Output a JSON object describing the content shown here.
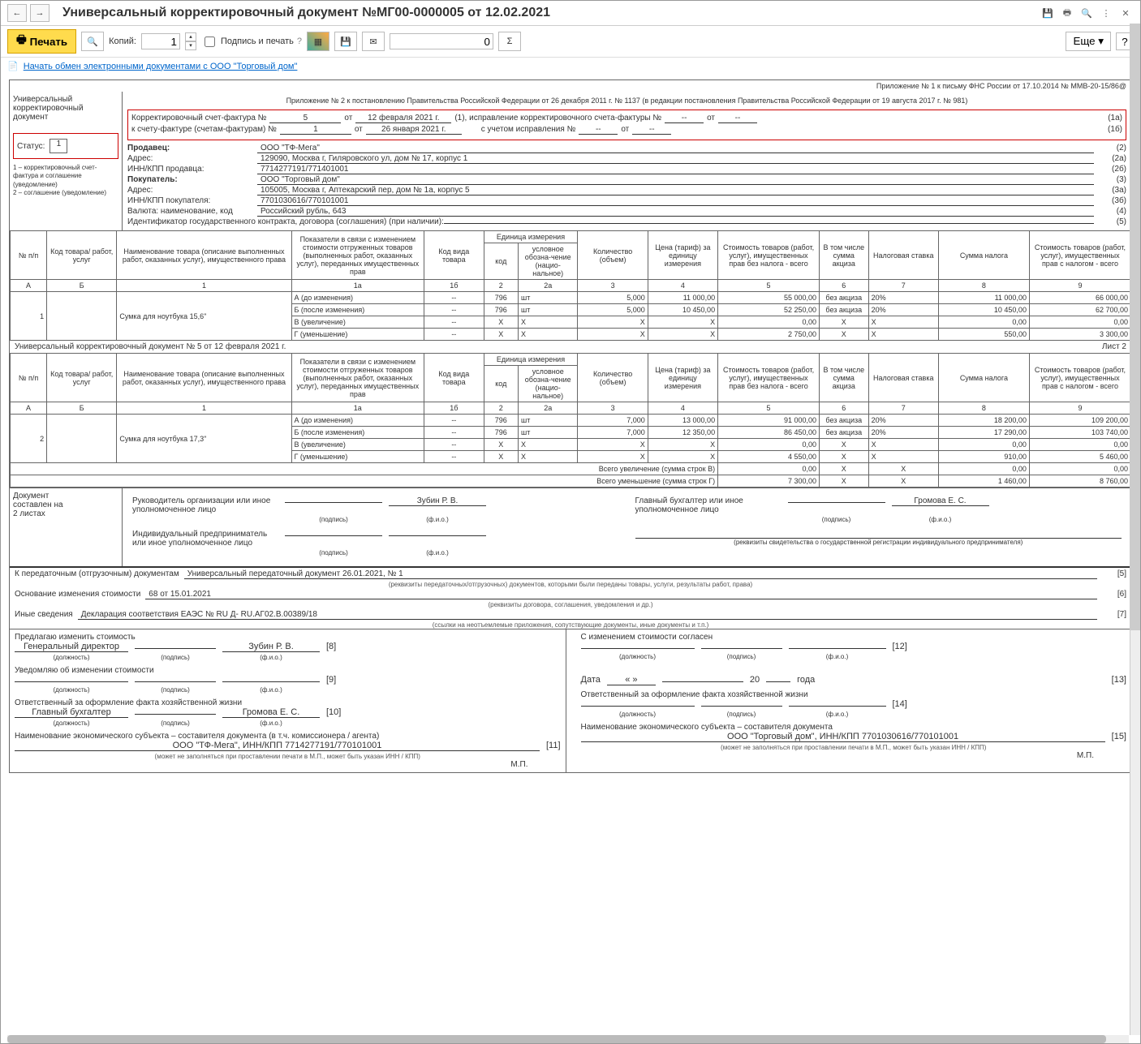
{
  "title": "Универсальный корректировочный документ №МГ00-0000005 от 12.02.2021",
  "toolbar": {
    "print": "Печать",
    "copies_label": "Копий:",
    "copies_value": "1",
    "sign_print": "Подпись и печать",
    "sum_value": "0",
    "more": "Еще",
    "help": "?",
    "sigma": "Σ"
  },
  "linkbar": {
    "link": "Начать обмен электронными документами с ООО \"Торговый дом\""
  },
  "left": {
    "title": "Универсальный корректировочный документ",
    "status_label": "Статус:",
    "status_value": "1",
    "legend": "1 – корректировочный счет-фактура и соглашение (уведомление)\n2 – соглашение (уведомление)"
  },
  "appendix": {
    "l1": "Приложение № 1 к письму ФНС России от 17.10.2014 № ММВ-20-15/86@",
    "l2": "Приложение № 2 к постановлению Правительства Российской Федерации от 26 декабря 2011 г. № 1137 (в редакции постановления Правительства Российской Федерации от 19 августа 2017 г. № 981)"
  },
  "hdr": {
    "l1_label": "Корректировочный счет-фактура №",
    "l1_num": "5",
    "l1_ot": "от",
    "l1_date": "12 февраля 2021 г.",
    "l1_after": "(1),  исправление корректировочного счета-фактуры №",
    "l1_dash": "--",
    "l1_ot2": "от",
    "l1_dash2": "--",
    "l1_code": "(1а)",
    "l2_label": "к счету-фактуре (счетам-фактурам) №",
    "l2_num": "1",
    "l2_ot": "от",
    "l2_date": "26 января 2021 г.",
    "l2_after": "с учетом исправления №",
    "l2_dash": "--",
    "l2_ot2": "от",
    "l2_dash2": "--",
    "l2_code": "(1б)"
  },
  "seller": {
    "label": "Продавец:",
    "val": "ООО \"ТФ-Мега\"",
    "code": "(2)"
  },
  "seller_addr": {
    "label": "Адрес:",
    "val": "129090, Москва г, Гиляровского ул, дом № 17, корпус 1",
    "code": "(2а)"
  },
  "seller_inn": {
    "label": "ИНН/КПП продавца:",
    "val": "7714277191/771401001",
    "code": "(2б)"
  },
  "buyer": {
    "label": "Покупатель:",
    "val": "ООО \"Торговый дом\"",
    "code": "(3)"
  },
  "buyer_addr": {
    "label": "Адрес:",
    "val": "105005, Москва г, Аптекарский пер, дом № 1а, корпус 5",
    "code": "(3а)"
  },
  "buyer_inn": {
    "label": "ИНН/КПП покупателя:",
    "val": "7701030616/770101001",
    "code": "(3б)"
  },
  "currency": {
    "label": "Валюта: наименование, код",
    "val": "Российский рубль, 643",
    "code": "(4)"
  },
  "contract": {
    "label": "Идентификатор государственного контракта, договора (соглашения) (при наличии):",
    "val": "",
    "code": "(5)"
  },
  "th": {
    "np": "№ п/п",
    "code": "Код товара/ работ, услуг",
    "name": "Наименование товара (описание выполненных работ, оказанных услуг), имущественного права",
    "ind": "Показатели в связи с изменением стоимости отгруженных товаров (выполненных работ, оказанных услуг), переданных имущественных прав",
    "kvt": "Код вида товара",
    "unit": "Единица измерения",
    "ucode": "код",
    "uname": "условное обозна-чение (нацио-нальное)",
    "qty": "Количество (объем)",
    "price": "Цена (тариф) за единицу измерения",
    "cost_no_tax": "Стоимость товаров (работ, услуг), имущественных прав без налога - всего",
    "excise": "В том числе сумма акциза",
    "rate": "Налоговая ставка",
    "tax": "Сумма налога",
    "cost_tax": "Стоимость товаров (работ, услуг), имущественных прав с налогом - всего"
  },
  "thn": {
    "a": "А",
    "b": "Б",
    "c1": "1",
    "c1a": "1а",
    "c1b": "1б",
    "c2": "2",
    "c2a": "2а",
    "c3": "3",
    "c4": "4",
    "c5": "5",
    "c6": "6",
    "c7": "7",
    "c8": "8",
    "c9": "9"
  },
  "rows1": [
    {
      "n": "1",
      "code": "",
      "name": "Сумка для ноутбука 15,6\"",
      "sub": [
        {
          "ind": "А (до изменения)",
          "kvt": "--",
          "uc": "796",
          "un": "шт",
          "qty": "5,000",
          "price": "11 000,00",
          "cost": "55 000,00",
          "ex": "без акциза",
          "rate": "20%",
          "tax": "11 000,00",
          "total": "66 000,00"
        },
        {
          "ind": "Б (после изменения)",
          "kvt": "--",
          "uc": "796",
          "un": "шт",
          "qty": "5,000",
          "price": "10 450,00",
          "cost": "52 250,00",
          "ex": "без акциза",
          "rate": "20%",
          "tax": "10 450,00",
          "total": "62 700,00"
        },
        {
          "ind": "В (увеличение)",
          "kvt": "--",
          "uc": "Х",
          "un": "Х",
          "qty": "Х",
          "price": "Х",
          "cost": "0,00",
          "ex": "Х",
          "rate": "Х",
          "tax": "0,00",
          "total": "0,00"
        },
        {
          "ind": "Г (уменьшение)",
          "kvt": "--",
          "uc": "Х",
          "un": "Х",
          "qty": "Х",
          "price": "Х",
          "cost": "2 750,00",
          "ex": "Х",
          "rate": "Х",
          "tax": "550,00",
          "total": "3 300,00"
        }
      ]
    }
  ],
  "sheet_line": {
    "left": "Универсальный корректировочный документ № 5 от 12 февраля 2021 г.",
    "right": "Лист 2"
  },
  "rows2": [
    {
      "n": "2",
      "code": "",
      "name": "Сумка для ноутбука 17,3\"",
      "sub": [
        {
          "ind": "А (до изменения)",
          "kvt": "--",
          "uc": "796",
          "un": "шт",
          "qty": "7,000",
          "price": "13 000,00",
          "cost": "91 000,00",
          "ex": "без акциза",
          "rate": "20%",
          "tax": "18 200,00",
          "total": "109 200,00"
        },
        {
          "ind": "Б (после изменения)",
          "kvt": "--",
          "uc": "796",
          "un": "шт",
          "qty": "7,000",
          "price": "12 350,00",
          "cost": "86 450,00",
          "ex": "без акциза",
          "rate": "20%",
          "tax": "17 290,00",
          "total": "103 740,00"
        },
        {
          "ind": "В (увеличение)",
          "kvt": "--",
          "uc": "Х",
          "un": "Х",
          "qty": "Х",
          "price": "Х",
          "cost": "0,00",
          "ex": "Х",
          "rate": "Х",
          "tax": "0,00",
          "total": "0,00"
        },
        {
          "ind": "Г (уменьшение)",
          "kvt": "--",
          "uc": "Х",
          "un": "Х",
          "qty": "Х",
          "price": "Х",
          "cost": "4 550,00",
          "ex": "Х",
          "rate": "Х",
          "tax": "910,00",
          "total": "5 460,00"
        }
      ]
    }
  ],
  "totals": {
    "inc_label": "Всего увеличение (сумма строк В)",
    "inc_cost": "0,00",
    "inc_ex": "Х",
    "inc_rate": "Х",
    "inc_tax": "0,00",
    "inc_total": "0,00",
    "dec_label": "Всего уменьшение (сумма строк Г)",
    "dec_cost": "7 300,00",
    "dec_ex": "Х",
    "dec_rate": "Х",
    "dec_tax": "1 460,00",
    "dec_total": "8 760,00"
  },
  "doc_pages": {
    "l1": "Документ",
    "l2": "составлен на",
    "l3": "2 листах"
  },
  "sign": {
    "head_label": "Руководитель организации или иное уполномоченное лицо",
    "head_name": "Зубин Р. В.",
    "acc_label": "Главный бухгалтер или иное уполномоченное лицо",
    "acc_name": "Громова Е. С.",
    "ip_label": "Индивидуальный предприниматель или иное уполномоченное лицо",
    "sig": "(подпись)",
    "fio": "(ф.и.о.)",
    "rekv": "(реквизиты свидетельства о государственной  регистрации индивидуального предпринимателя)"
  },
  "f5": {
    "label": "К передаточным (отгрузочным) документам",
    "val": "Универсальный передаточный документ 26.01.2021, № 1",
    "code": "[5]",
    "hint": "(реквизиты передаточных/отгрузочных) документов, которыми были переданы товары, услуги, результаты работ, права)"
  },
  "f6": {
    "label": "Основание изменения стоимости",
    "val": "68 от 15.01.2021",
    "code": "[6]",
    "hint": "(реквизиты договора, соглашения, уведомления и др.)"
  },
  "f7": {
    "label": "Иные сведения",
    "val": "Декларация соответствия ЕАЭС № RU Д- RU.АГ02.В.00389/18",
    "code": "[7]",
    "hint": "(ссылки на неотъемлемые приложения, сопутствующие документы, иные документы и т.п.)"
  },
  "left_block": {
    "propose": "Предлагаю изменить стоимость",
    "gen_dir": "Генеральный директор",
    "zubin": "Зубин Р. В.",
    "c8": "[8]",
    "notify": "Уведомляю об изменении стоимости",
    "c9": "[9]",
    "resp": "Ответственный за оформление факта хозяйственной жизни",
    "chief_acc": "Главный бухгалтер",
    "gromova": "Громова Е. С.",
    "c10": "[10]",
    "econ": "Наименование экономического субъекта – составителя документа (в т.ч. комиссионера / агента)",
    "econ_val": "ООО \"ТФ-Мега\", ИНН/КПП 7714277191/770101001",
    "c11": "[11]",
    "mp_hint": "(может не заполняться при проставлении печати в М.П., может быть указан ИНН / КПП)",
    "mp": "М.П."
  },
  "right_block": {
    "agree": "С изменением стоимости согласен",
    "c12": "[12]",
    "date_label": "Дата",
    "date_quote": "«     »",
    "date_year": "20",
    "date_suf": "года",
    "c13": "[13]",
    "resp": "Ответственный за оформление факта хозяйственной жизни",
    "c14": "[14]",
    "econ": "Наименование экономического субъекта – составителя документа",
    "econ_val": "ООО \"Торговый дом\", ИНН/КПП 7701030616/770101001",
    "c15": "[15]",
    "mp_hint": "(может не заполняться при проставлении печати в М.П., может быть указан ИНН / КПП)",
    "mp": "М.П."
  },
  "caps": {
    "dolzh": "(должность)",
    "podpis": "(подпись)",
    "fio": "(ф.и.о.)"
  }
}
